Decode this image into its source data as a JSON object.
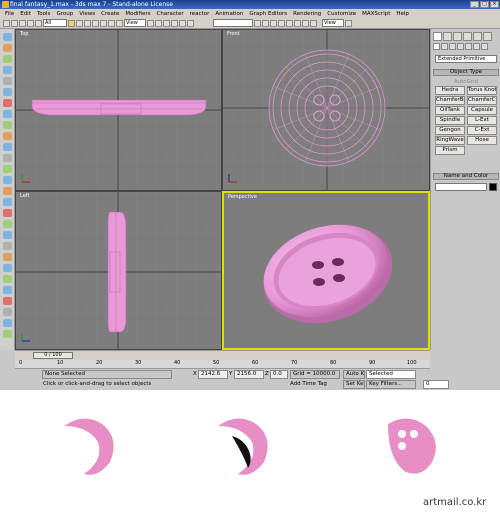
{
  "window": {
    "title": "final fantasy_1.max - 3ds max 7  - Stand-alone License",
    "controls": [
      "_",
      "□",
      "×"
    ]
  },
  "menu": [
    "File",
    "Edit",
    "Tools",
    "Group",
    "Views",
    "Create",
    "Modifiers",
    "Character",
    "reactor",
    "Animation",
    "Graph Editors",
    "Rendering",
    "Customize",
    "MAXScript",
    "Help"
  ],
  "toolbar": {
    "selection_filter": "All",
    "reference_coord": "View",
    "named_selection": "",
    "right_view": "View"
  },
  "viewports": {
    "top": "Top",
    "front": "Front",
    "left": "Left",
    "perspective": "Perspective"
  },
  "command_panel": {
    "category_select": "Extended Primitive",
    "object_type_title": "Object Type",
    "autogrid_label": "AutoGrid",
    "primitives": [
      "Hedra",
      "Torus Knot",
      "ChamferBox",
      "ChamferCyl",
      "OilTank",
      "Capsule",
      "Spindle",
      "L-Ext",
      "Gengon",
      "C-Ext",
      "RingWave",
      "Hose",
      "Prism"
    ],
    "name_color_title": "Name and Color"
  },
  "timeline": {
    "frame_readout": "0 / 100",
    "ruler_ticks": [
      "0",
      "10",
      "20",
      "30",
      "40",
      "50",
      "60",
      "70",
      "80",
      "90",
      "100"
    ]
  },
  "status": {
    "selection": "None Selected",
    "prompt": "Click or click-and-drag to select objects",
    "x_label": "X",
    "x_value": "2142.6",
    "y_label": "Y",
    "y_value": "2156.0",
    "z_label": "Z",
    "z_value": "0.0",
    "grid": "Grid = 10000.0",
    "add_time_tag": "Add Time Tag",
    "auto_key": "Auto Key",
    "set_key": "Set Key",
    "selected_option": "Selected",
    "key_filters": "Key Filters...",
    "frame": "0"
  },
  "colors": {
    "object_pink": "#e89ad8",
    "piece_pink": "#e88ec6",
    "viewport_gray": "#7d7d7d",
    "grid_line": "#8a8a8a",
    "active_border": "#e0e000"
  },
  "footer": {
    "watermark": "artmail.co.kr"
  }
}
